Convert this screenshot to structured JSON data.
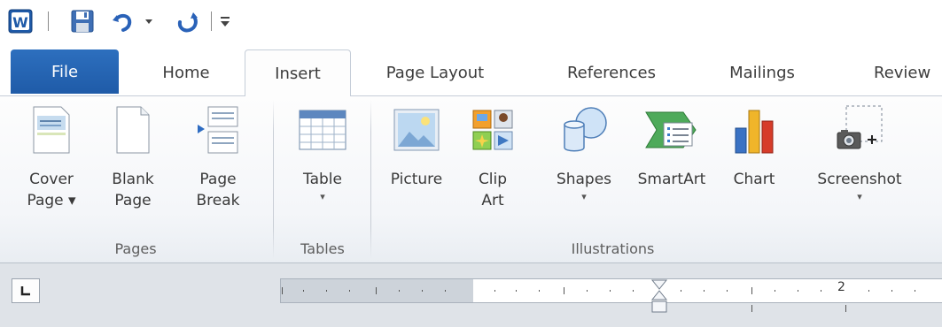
{
  "quick_access": {
    "icons": [
      "word-app-icon",
      "save-icon",
      "undo-icon",
      "undo-dropdown-icon",
      "redo-icon",
      "customize-qat-icon"
    ],
    "word_letter": "W"
  },
  "tabs": [
    {
      "label": "File",
      "active": false
    },
    {
      "label": "Home",
      "active": false
    },
    {
      "label": "Insert",
      "active": true
    },
    {
      "label": "Page Layout",
      "active": false
    },
    {
      "label": "References",
      "active": false
    },
    {
      "label": "Mailings",
      "active": false
    },
    {
      "label": "Review",
      "active": false
    }
  ],
  "ribbon": {
    "groups": [
      {
        "label": "Pages",
        "buttons": [
          {
            "line1": "Cover",
            "line2": "Page ▾",
            "icon": "cover-page-icon"
          },
          {
            "line1": "Blank",
            "line2": "Page",
            "icon": "blank-page-icon"
          },
          {
            "line1": "Page",
            "line2": "Break",
            "icon": "page-break-icon"
          }
        ]
      },
      {
        "label": "Tables",
        "buttons": [
          {
            "line1": "Table",
            "line2": "▾",
            "icon": "table-icon"
          }
        ]
      },
      {
        "label": "Illustrations",
        "buttons": [
          {
            "line1": "Picture",
            "line2": "",
            "icon": "picture-icon"
          },
          {
            "line1": "Clip",
            "line2": "Art",
            "icon": "clip-art-icon"
          },
          {
            "line1": "Shapes",
            "line2": "▾",
            "icon": "shapes-icon"
          },
          {
            "line1": "SmartArt",
            "line2": "",
            "icon": "smartart-icon"
          },
          {
            "line1": "Chart",
            "line2": "",
            "icon": "chart-icon"
          },
          {
            "line1": "Screenshot",
            "line2": "▾",
            "icon": "screenshot-icon"
          }
        ]
      }
    ]
  },
  "ruler": {
    "number_label": "2",
    "tab_selector_icon": "left-tab-stop-icon"
  },
  "colors": {
    "file_tab": "#2b69b8",
    "ribbon_bg": "#f4f6f9",
    "ruler_bar": "#dfe3e8"
  }
}
